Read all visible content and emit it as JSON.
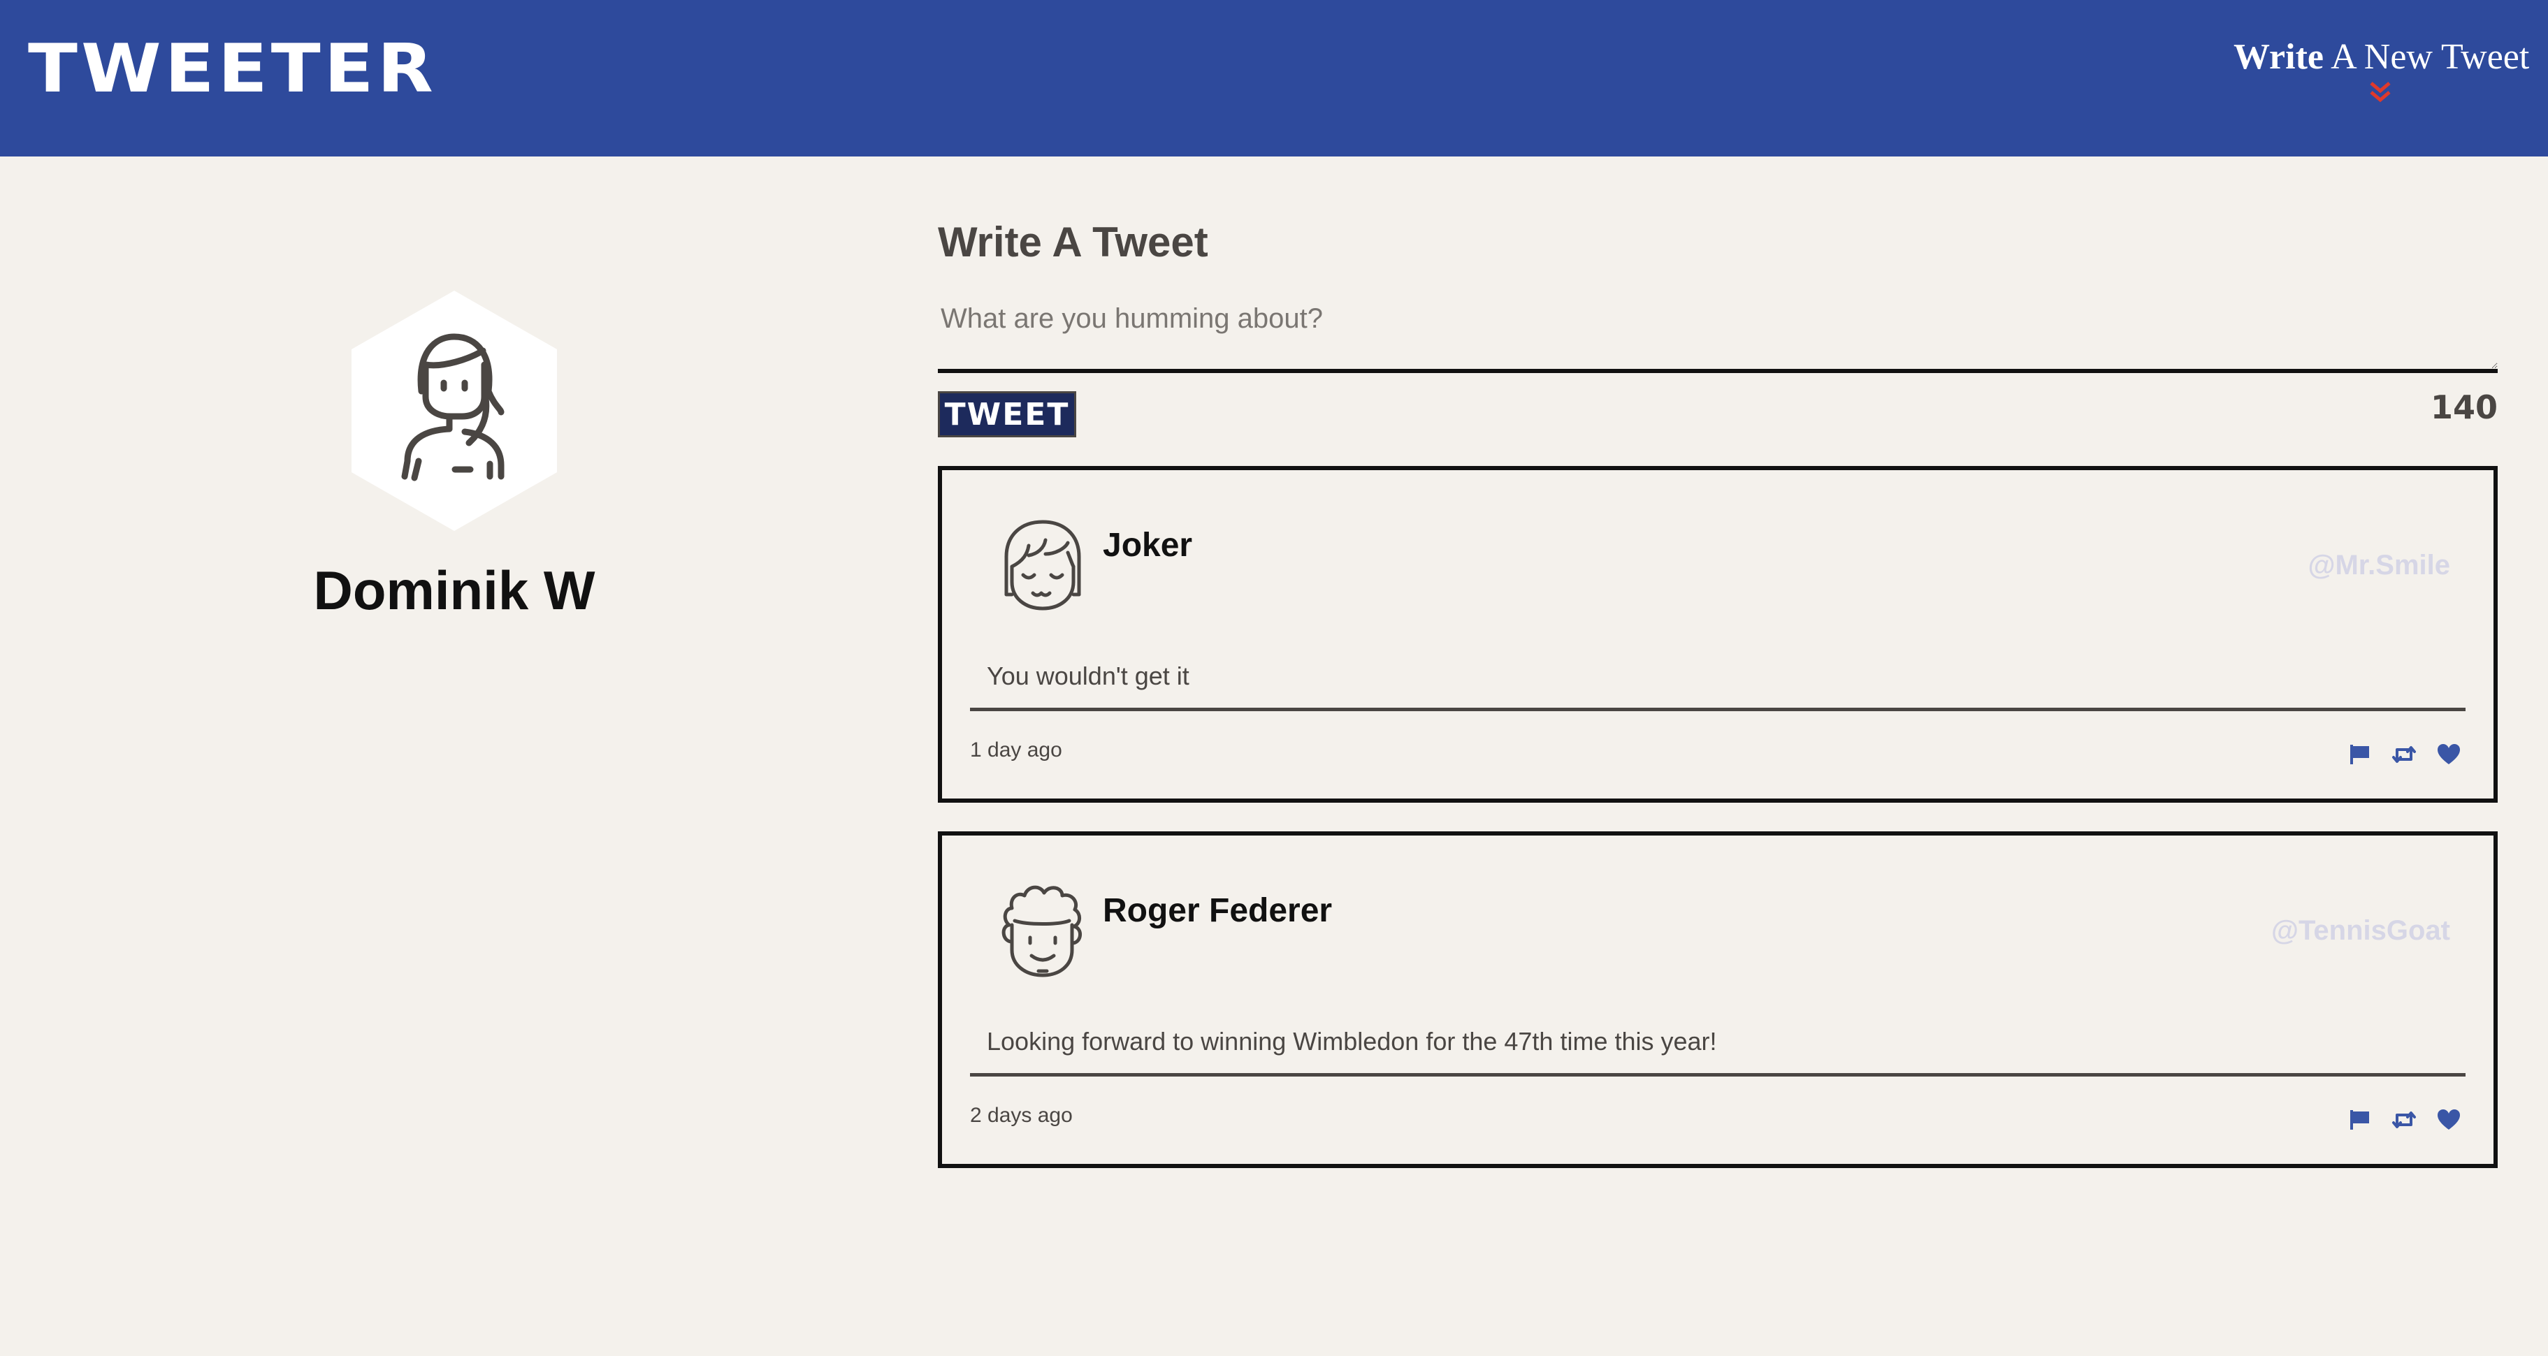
{
  "nav": {
    "brand": "TWEETER",
    "compose_bold": "Write",
    "compose_rest": " A New Tweet"
  },
  "profile": {
    "name": "Dominik W"
  },
  "compose": {
    "title": "Write A Tweet",
    "placeholder": "What are you humming about?",
    "button_label": "TWEET",
    "counter": "140"
  },
  "tweets": [
    {
      "name": "Joker",
      "handle": "@Mr.Smile",
      "text": "You wouldn't get it",
      "time": "1 day ago"
    },
    {
      "name": "Roger Federer",
      "handle": "@TennisGoat",
      "text": "Looking forward to winning Wimbledon for the 47th time this year!",
      "time": "2 days ago"
    }
  ],
  "icons": {
    "flag": "flag-icon",
    "retweet": "retweet-icon",
    "like": "heart-icon",
    "nav_chevron": "chevron-double-down-icon"
  },
  "colors": {
    "nav_bg": "#2e4a9c",
    "page_bg": "#f4f1ec",
    "accent_red": "#e0392b",
    "action_blue": "#3a56a6",
    "handle_gray": "#d6d6e6",
    "tweet_button_bg": "#1d2a5c"
  }
}
